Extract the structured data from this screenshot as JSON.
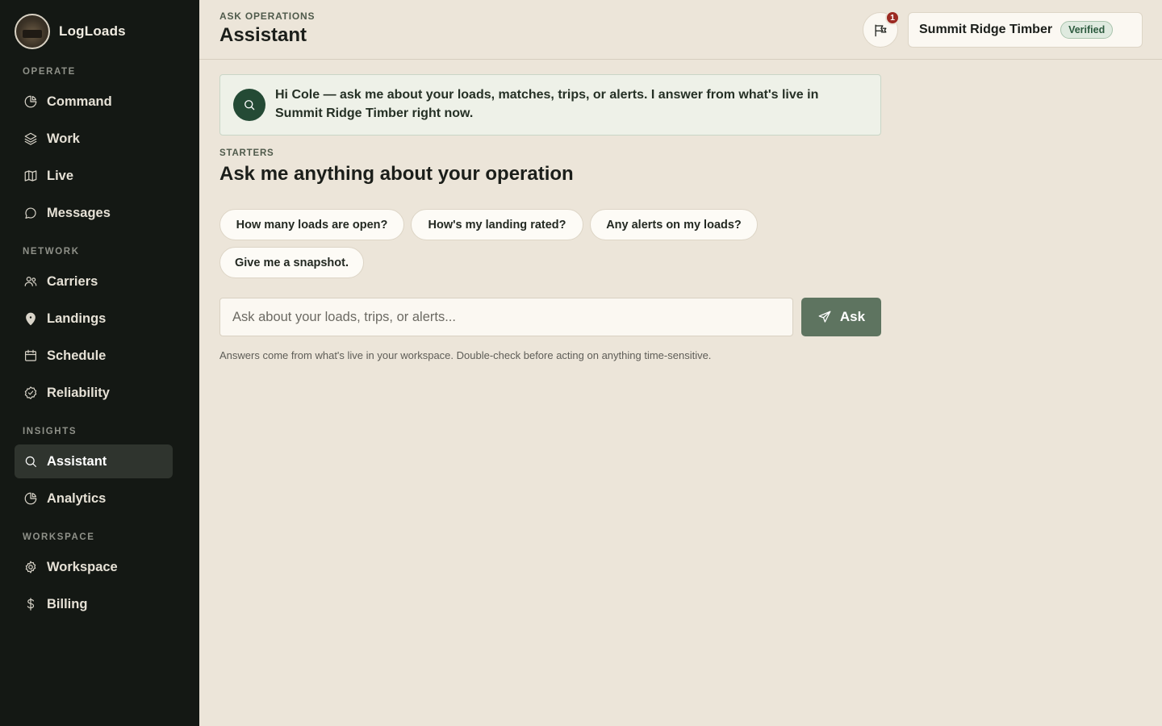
{
  "brand": {
    "name": "LogLoads"
  },
  "sidebar": {
    "sections": [
      {
        "label": "OPERATE"
      },
      {
        "label": "NETWORK"
      },
      {
        "label": "INSIGHTS"
      },
      {
        "label": "WORKSPACE"
      }
    ],
    "items": [
      {
        "label": "Command",
        "icon": "pie-chart-icon"
      },
      {
        "label": "Work",
        "icon": "layers-icon"
      },
      {
        "label": "Live",
        "icon": "map-icon"
      },
      {
        "label": "Messages",
        "icon": "chat-bubble-icon"
      },
      {
        "label": "Carriers",
        "icon": "users-icon"
      },
      {
        "label": "Landings",
        "icon": "map-pin-icon"
      },
      {
        "label": "Schedule",
        "icon": "calendar-icon"
      },
      {
        "label": "Reliability",
        "icon": "badge-check-icon"
      },
      {
        "label": "Assistant",
        "icon": "search-icon",
        "active": true
      },
      {
        "label": "Analytics",
        "icon": "pie-chart-icon"
      },
      {
        "label": "Workspace",
        "icon": "gear-icon"
      },
      {
        "label": "Billing",
        "icon": "dollar-icon"
      }
    ]
  },
  "header": {
    "eyebrow": "ASK OPERATIONS",
    "title": "Assistant",
    "notifications": {
      "count": "1",
      "icon": "megaphone-icon"
    },
    "org": {
      "name": "Summit Ridge Timber",
      "badge": "Verified"
    }
  },
  "intro": {
    "text": "Hi Cole — ask me about your loads, matches, trips, or alerts. I answer from what's live in Summit Ridge Timber right now.",
    "icon": "search-icon"
  },
  "starters": {
    "label": "STARTERS",
    "title": "Ask me anything about your operation",
    "chips": [
      "How many loads are open?",
      "How's my landing rated?",
      "Any alerts on my loads?",
      "Give me a snapshot."
    ]
  },
  "ask": {
    "placeholder": "Ask about your loads, trips, or alerts...",
    "button_label": "Ask",
    "disclaimer": "Answers come from what's live in your workspace. Double-check before acting on anything time-sensitive."
  },
  "colors": {
    "sidebar_bg": "#141814",
    "page_bg": "#ece5d9",
    "accent": "#244a35",
    "ask_button": "#5e7460",
    "badge_red": "#9c2a22"
  }
}
